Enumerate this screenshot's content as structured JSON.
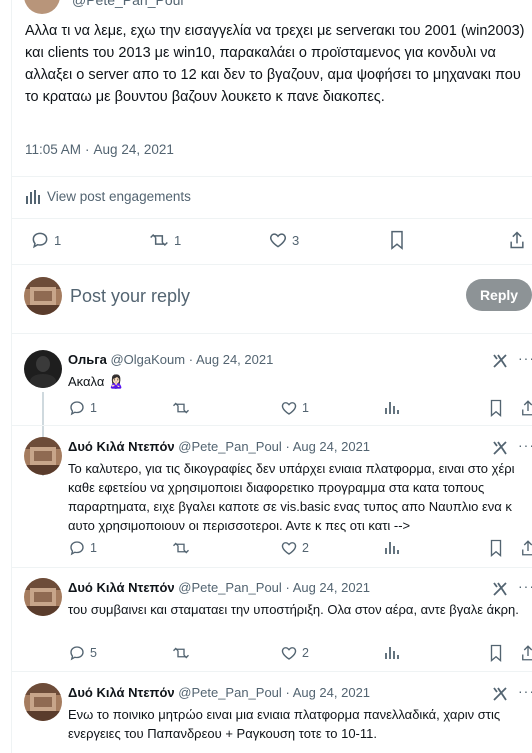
{
  "header": {
    "handle": "@Pete_Pan_Poul"
  },
  "post": {
    "text": "Αλλα τι να λεμε, εχω την εισαγγελία να τρεχει με serverακι του 2001 (win2003) και clients του 2013 με win10, παρακαλάει ο προϊσταμενος για κονδυλι να αλλαξει ο server απο το 12 και δεν το βγαζουν, αμα ψοφήσει το μηχανακι που το κραταω με βουντου βαζουν λουκετο κ πανε διακοπες.",
    "time": "11:05 AM",
    "date": "Aug 24, 2021",
    "engagements_label": "View post engagements",
    "stats": {
      "replies": "1",
      "reposts": "1",
      "likes": "3"
    }
  },
  "reply_box": {
    "placeholder": "Post your reply",
    "button": "Reply"
  },
  "comments": [
    {
      "name": "Ольга",
      "handle": "@OlgaKoum",
      "date": "Aug 24, 2021",
      "text": "Ακαλα 🙎🏻‍♀️",
      "replies": "1",
      "reposts": "",
      "likes": "1"
    },
    {
      "name": "Δυό Κιλά Ντεπόν",
      "handle": "@Pete_Pan_Poul",
      "date": "Aug 24, 2021",
      "text": "Το καλυτερο, για τις δικογραφίες δεν υπάρχει ενιαια πλατφορμα, ειναι στο χέρι καθε εφετείου να χρησιμοποιει διαφορετικο προγραμμα στα κατα τοπους παραρτηματα, ειχε βγαλει καποτε σε vis.basic ενας τυπος απο Ναυπλιο ενα κ αυτο χρησιμοποιουν οι περισσοτεροι. Αντε κ πες οτι κατι -->",
      "replies": "1",
      "reposts": "",
      "likes": "2"
    },
    {
      "name": "Δυό Κιλά Ντεπόν",
      "handle": "@Pete_Pan_Poul",
      "date": "Aug 24, 2021",
      "text": "του συμβαινει και σταματαει την υποστήριξη. Ολα στον αέρα, αντε βγαλε άκρη.",
      "replies": "5",
      "reposts": "",
      "likes": "2"
    },
    {
      "name": "Δυό Κιλά Ντεπόν",
      "handle": "@Pete_Pan_Poul",
      "date": "Aug 24, 2021",
      "text": "Ενω το ποινικο μητρώο ειναι μια ενιαια πλατφορμα πανελλαδικά, χαριν στις ενεργειες του Παπανδρεου + Ραγκουση τοτε το 10-11.",
      "replies": "",
      "reposts": "",
      "likes": ""
    }
  ],
  "colors": {
    "text": "#0f1419",
    "muted": "#536471",
    "border": "#eff3f4",
    "reply_button": "#8d9396"
  }
}
